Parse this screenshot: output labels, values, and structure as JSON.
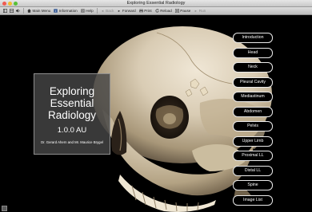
{
  "window": {
    "title": "Exploring Essential Radiology"
  },
  "toolbar": {
    "main_menu": "Main Menu",
    "information": "Information",
    "help": "Help",
    "back": "Back",
    "forward": "Forward",
    "print": "Print",
    "reload": "Reload",
    "pause": "Pause",
    "run": "Run"
  },
  "cover": {
    "title_line1": "Exploring",
    "title_line2": "Essential",
    "title_line3": "Radiology",
    "version": "1.0.0 AU",
    "authors": "Dr. Gerard Ahern and Mr. Maurice Brygel"
  },
  "nav": {
    "items": [
      {
        "label": "Introduction"
      },
      {
        "label": "Head"
      },
      {
        "label": "Neck"
      },
      {
        "label": "Pleural Cavity"
      },
      {
        "label": "Mediastinum"
      },
      {
        "label": "Abdomen"
      },
      {
        "label": "Pelvis"
      },
      {
        "label": "Upper Limb"
      },
      {
        "label": "Proximal LL"
      },
      {
        "label": "Distal LL"
      },
      {
        "label": "Spine"
      },
      {
        "label": "Image List"
      }
    ]
  },
  "icons": {
    "close": "close-icon",
    "minimize": "minimize-icon",
    "zoom": "zoom-icon"
  },
  "colors": {
    "background": "#000000",
    "bone": "#d8cbb5",
    "overlay": "#464646"
  }
}
